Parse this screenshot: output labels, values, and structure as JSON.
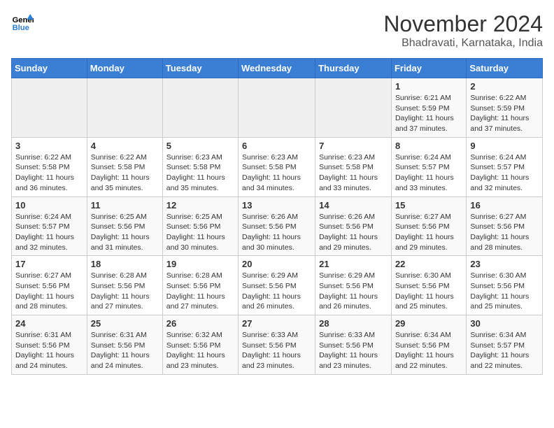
{
  "logo": {
    "text_general": "General",
    "text_blue": "Blue"
  },
  "header": {
    "month": "November 2024",
    "location": "Bhadravati, Karnataka, India"
  },
  "weekdays": [
    "Sunday",
    "Monday",
    "Tuesday",
    "Wednesday",
    "Thursday",
    "Friday",
    "Saturday"
  ],
  "weeks": [
    [
      {
        "day": "",
        "detail": ""
      },
      {
        "day": "",
        "detail": ""
      },
      {
        "day": "",
        "detail": ""
      },
      {
        "day": "",
        "detail": ""
      },
      {
        "day": "",
        "detail": ""
      },
      {
        "day": "1",
        "detail": "Sunrise: 6:21 AM\nSunset: 5:59 PM\nDaylight: 11 hours and 37 minutes."
      },
      {
        "day": "2",
        "detail": "Sunrise: 6:22 AM\nSunset: 5:59 PM\nDaylight: 11 hours and 37 minutes."
      }
    ],
    [
      {
        "day": "3",
        "detail": "Sunrise: 6:22 AM\nSunset: 5:58 PM\nDaylight: 11 hours and 36 minutes."
      },
      {
        "day": "4",
        "detail": "Sunrise: 6:22 AM\nSunset: 5:58 PM\nDaylight: 11 hours and 35 minutes."
      },
      {
        "day": "5",
        "detail": "Sunrise: 6:23 AM\nSunset: 5:58 PM\nDaylight: 11 hours and 35 minutes."
      },
      {
        "day": "6",
        "detail": "Sunrise: 6:23 AM\nSunset: 5:58 PM\nDaylight: 11 hours and 34 minutes."
      },
      {
        "day": "7",
        "detail": "Sunrise: 6:23 AM\nSunset: 5:58 PM\nDaylight: 11 hours and 33 minutes."
      },
      {
        "day": "8",
        "detail": "Sunrise: 6:24 AM\nSunset: 5:57 PM\nDaylight: 11 hours and 33 minutes."
      },
      {
        "day": "9",
        "detail": "Sunrise: 6:24 AM\nSunset: 5:57 PM\nDaylight: 11 hours and 32 minutes."
      }
    ],
    [
      {
        "day": "10",
        "detail": "Sunrise: 6:24 AM\nSunset: 5:57 PM\nDaylight: 11 hours and 32 minutes."
      },
      {
        "day": "11",
        "detail": "Sunrise: 6:25 AM\nSunset: 5:56 PM\nDaylight: 11 hours and 31 minutes."
      },
      {
        "day": "12",
        "detail": "Sunrise: 6:25 AM\nSunset: 5:56 PM\nDaylight: 11 hours and 30 minutes."
      },
      {
        "day": "13",
        "detail": "Sunrise: 6:26 AM\nSunset: 5:56 PM\nDaylight: 11 hours and 30 minutes."
      },
      {
        "day": "14",
        "detail": "Sunrise: 6:26 AM\nSunset: 5:56 PM\nDaylight: 11 hours and 29 minutes."
      },
      {
        "day": "15",
        "detail": "Sunrise: 6:27 AM\nSunset: 5:56 PM\nDaylight: 11 hours and 29 minutes."
      },
      {
        "day": "16",
        "detail": "Sunrise: 6:27 AM\nSunset: 5:56 PM\nDaylight: 11 hours and 28 minutes."
      }
    ],
    [
      {
        "day": "17",
        "detail": "Sunrise: 6:27 AM\nSunset: 5:56 PM\nDaylight: 11 hours and 28 minutes."
      },
      {
        "day": "18",
        "detail": "Sunrise: 6:28 AM\nSunset: 5:56 PM\nDaylight: 11 hours and 27 minutes."
      },
      {
        "day": "19",
        "detail": "Sunrise: 6:28 AM\nSunset: 5:56 PM\nDaylight: 11 hours and 27 minutes."
      },
      {
        "day": "20",
        "detail": "Sunrise: 6:29 AM\nSunset: 5:56 PM\nDaylight: 11 hours and 26 minutes."
      },
      {
        "day": "21",
        "detail": "Sunrise: 6:29 AM\nSunset: 5:56 PM\nDaylight: 11 hours and 26 minutes."
      },
      {
        "day": "22",
        "detail": "Sunrise: 6:30 AM\nSunset: 5:56 PM\nDaylight: 11 hours and 25 minutes."
      },
      {
        "day": "23",
        "detail": "Sunrise: 6:30 AM\nSunset: 5:56 PM\nDaylight: 11 hours and 25 minutes."
      }
    ],
    [
      {
        "day": "24",
        "detail": "Sunrise: 6:31 AM\nSunset: 5:56 PM\nDaylight: 11 hours and 24 minutes."
      },
      {
        "day": "25",
        "detail": "Sunrise: 6:31 AM\nSunset: 5:56 PM\nDaylight: 11 hours and 24 minutes."
      },
      {
        "day": "26",
        "detail": "Sunrise: 6:32 AM\nSunset: 5:56 PM\nDaylight: 11 hours and 23 minutes."
      },
      {
        "day": "27",
        "detail": "Sunrise: 6:33 AM\nSunset: 5:56 PM\nDaylight: 11 hours and 23 minutes."
      },
      {
        "day": "28",
        "detail": "Sunrise: 6:33 AM\nSunset: 5:56 PM\nDaylight: 11 hours and 23 minutes."
      },
      {
        "day": "29",
        "detail": "Sunrise: 6:34 AM\nSunset: 5:56 PM\nDaylight: 11 hours and 22 minutes."
      },
      {
        "day": "30",
        "detail": "Sunrise: 6:34 AM\nSunset: 5:57 PM\nDaylight: 11 hours and 22 minutes."
      }
    ]
  ]
}
